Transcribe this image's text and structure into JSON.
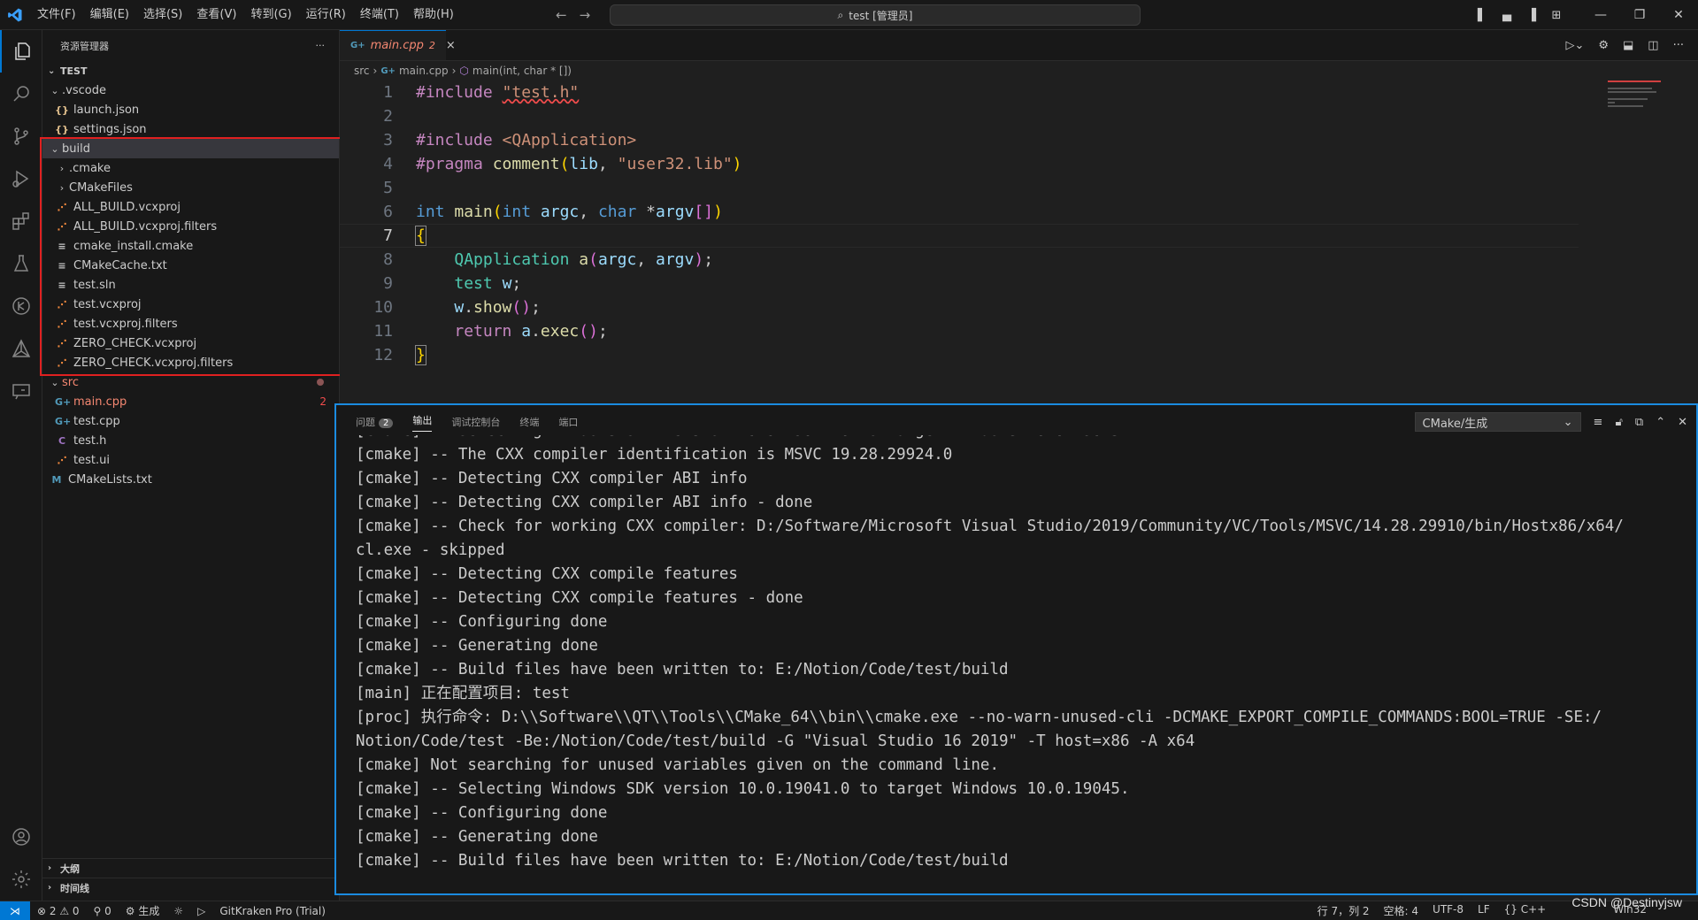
{
  "titlebar": {
    "menu": [
      "文件(F)",
      "编辑(E)",
      "选择(S)",
      "查看(V)",
      "转到(G)",
      "运行(R)",
      "终端(T)",
      "帮助(H)"
    ],
    "search": "test [管理员]"
  },
  "sidebar": {
    "title": "资源管理器",
    "more": "···",
    "root": "TEST",
    "tree": [
      {
        "label": ".vscode",
        "depth": 1,
        "kind": "folder-open",
        "icon": "",
        "icon_color": ""
      },
      {
        "label": "launch.json",
        "depth": 2,
        "kind": "file",
        "icon": "{}",
        "icon_color": "#e2c08d"
      },
      {
        "label": "settings.json",
        "depth": 2,
        "kind": "file",
        "icon": "{}",
        "icon_color": "#e2c08d"
      },
      {
        "label": "build",
        "depth": 1,
        "kind": "folder-open",
        "icon": "",
        "icon_color": "",
        "selected": true
      },
      {
        "label": ".cmake",
        "depth": 2,
        "kind": "folder",
        "icon": "",
        "icon_color": ""
      },
      {
        "label": "CMakeFiles",
        "depth": 2,
        "kind": "folder",
        "icon": "",
        "icon_color": ""
      },
      {
        "label": "ALL_BUILD.vcxproj",
        "depth": 2,
        "kind": "file",
        "icon": "rss",
        "icon_color": "#f0883e"
      },
      {
        "label": "ALL_BUILD.vcxproj.filters",
        "depth": 2,
        "kind": "file",
        "icon": "rss",
        "icon_color": "#f0883e"
      },
      {
        "label": "cmake_install.cmake",
        "depth": 2,
        "kind": "file",
        "icon": "lines",
        "icon_color": "#c5c5c5"
      },
      {
        "label": "CMakeCache.txt",
        "depth": 2,
        "kind": "file",
        "icon": "lines",
        "icon_color": "#c5c5c5"
      },
      {
        "label": "test.sln",
        "depth": 2,
        "kind": "file",
        "icon": "lines",
        "icon_color": "#c5c5c5"
      },
      {
        "label": "test.vcxproj",
        "depth": 2,
        "kind": "file",
        "icon": "rss",
        "icon_color": "#f0883e"
      },
      {
        "label": "test.vcxproj.filters",
        "depth": 2,
        "kind": "file",
        "icon": "rss",
        "icon_color": "#f0883e"
      },
      {
        "label": "ZERO_CHECK.vcxproj",
        "depth": 2,
        "kind": "file",
        "icon": "rss",
        "icon_color": "#f0883e"
      },
      {
        "label": "ZERO_CHECK.vcxproj.filters",
        "depth": 2,
        "kind": "file",
        "icon": "rss",
        "icon_color": "#f0883e"
      },
      {
        "label": "src",
        "depth": 1,
        "kind": "folder-open",
        "icon": "",
        "icon_color": "",
        "error": true,
        "dot": true
      },
      {
        "label": "main.cpp",
        "depth": 2,
        "kind": "file",
        "icon": "G+",
        "icon_color": "#519aba",
        "error": true,
        "badge": "2"
      },
      {
        "label": "test.cpp",
        "depth": 2,
        "kind": "file",
        "icon": "G+",
        "icon_color": "#519aba"
      },
      {
        "label": "test.h",
        "depth": 2,
        "kind": "file",
        "icon": "C",
        "icon_color": "#a074c4"
      },
      {
        "label": "test.ui",
        "depth": 2,
        "kind": "file",
        "icon": "rss",
        "icon_color": "#f0883e"
      },
      {
        "label": "CMakeLists.txt",
        "depth": 1,
        "kind": "file",
        "icon": "M",
        "icon_color": "#519aba"
      }
    ],
    "outline": "大纲",
    "timeline": "时间线"
  },
  "editor": {
    "tab": {
      "icon": "G+",
      "name": "main.cpp",
      "count": "2",
      "close": "×"
    },
    "breadcrumb": [
      "src",
      "main.cpp",
      "main(int, char * [])"
    ],
    "line_numbers": [
      "1",
      "2",
      "3",
      "4",
      "5",
      "6",
      "7",
      "8",
      "9",
      "10",
      "11",
      "12"
    ]
  },
  "panel": {
    "tabs": [
      "问题",
      "输出",
      "调试控制台",
      "终端",
      "端口"
    ],
    "problems_count": "2",
    "channel": "CMake/生成",
    "output": [
      "[cmake] -- Selecting Windows SDK version 10.0.19041.0 to target Windows 10.0.19045.",
      "[cmake] -- The CXX compiler identification is MSVC 19.28.29924.0",
      "[cmake] -- Detecting CXX compiler ABI info",
      "[cmake] -- Detecting CXX compiler ABI info - done",
      "[cmake] -- Check for working CXX compiler: D:/Software/Microsoft Visual Studio/2019/Community/VC/Tools/MSVC/14.28.29910/bin/Hostx86/x64/",
      "cl.exe - skipped",
      "[cmake] -- Detecting CXX compile features",
      "[cmake] -- Detecting CXX compile features - done",
      "[cmake] -- Configuring done",
      "[cmake] -- Generating done",
      "[cmake] -- Build files have been written to: E:/Notion/Code/test/build",
      "[main] 正在配置项目: test",
      "[proc] 执行命令: D:\\\\Software\\\\QT\\\\Tools\\\\CMake_64\\\\bin\\\\cmake.exe --no-warn-unused-cli -DCMAKE_EXPORT_COMPILE_COMMANDS:BOOL=TRUE -SE:/",
      "Notion/Code/test -Be:/Notion/Code/test/build -G \"Visual Studio 16 2019\" -T host=x86 -A x64",
      "[cmake] Not searching for unused variables given on the command line.",
      "[cmake] -- Selecting Windows SDK version 10.0.19041.0 to target Windows 10.0.19045.",
      "[cmake] -- Configuring done",
      "[cmake] -- Generating done",
      "[cmake] -- Build files have been written to: E:/Notion/Code/test/build"
    ]
  },
  "statusbar": {
    "errors": "⊗ 2 ⚠ 0",
    "ports": "⚲ 0",
    "build": "⚙ 生成",
    "gitkraken": "GitKraken Pro (Trial)",
    "position": "行 7，列 2",
    "spaces": "空格: 4",
    "encoding": "UTF-8",
    "eol": "LF",
    "lang": "{} C++",
    "platform": "Win32"
  },
  "watermark": "CSDN @Destinyjsw",
  "colors": {
    "accent": "#0078d4",
    "highlight_box": "#e02020",
    "panel_border": "#1b8be0"
  }
}
